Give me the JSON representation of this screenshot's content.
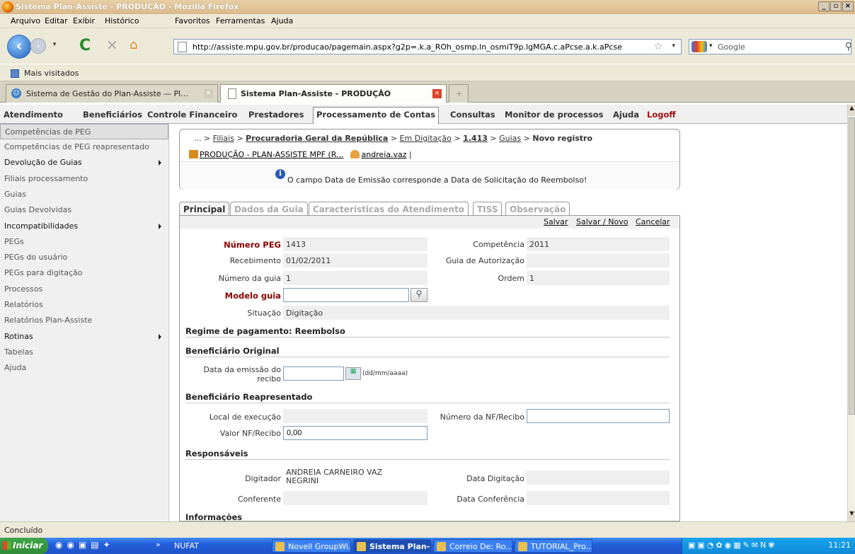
{
  "window": {
    "title": "Sistema Plan-Assiste - PRODUÇÃO - Mozilla Firefox",
    "controls": [
      "_",
      "▫",
      "×"
    ]
  },
  "menu": [
    "Arquivo",
    "Editar",
    "Exibir",
    "Histórico",
    "Favoritos",
    "Ferramentas",
    "Ajuda"
  ],
  "nav": {
    "url": "http://assiste.mpu.gov.br/producao/pagemain.aspx?g2p=.k.a_ROh_osmp.ln_osmiT9p.lgMGA.c.aPcse.a.k.aPcse",
    "search_placeholder": "Google"
  },
  "bookmarks": {
    "label": "Mais visitados"
  },
  "browser_tabs": [
    {
      "label": "Sistema de Gestão do Plan-Assiste — Pl..."
    },
    {
      "label": "Sistema Plan-Assiste - PRODUÇÃO"
    },
    {
      "label": "+"
    }
  ],
  "app_menu": [
    "Atendimento",
    "Beneficiários",
    "Controle Financeiro",
    "Prestadores",
    "Processamento de Contas",
    "Consultas",
    "Monitor de processos",
    "Ajuda",
    "Logoff"
  ],
  "sidebar": [
    {
      "label": "Competências de PEG",
      "sub": false
    },
    {
      "label": "Competências de PEG reapresentado",
      "sub": false
    },
    {
      "label": "Devolução de Guias",
      "sub": true
    },
    {
      "label": "Filiais processamento",
      "sub": false
    },
    {
      "label": "Guias",
      "sub": false
    },
    {
      "label": "Guias Devolvidas",
      "sub": false
    },
    {
      "label": "Incompatibilidades",
      "sub": true
    },
    {
      "label": "PEGs",
      "sub": false
    },
    {
      "label": "PEGs do usuário",
      "sub": false
    },
    {
      "label": "PEGs para digitação",
      "sub": false
    },
    {
      "label": "Processos",
      "sub": false
    },
    {
      "label": "Relatórios",
      "sub": false
    },
    {
      "label": "Relatórios Plan-Assiste",
      "sub": false
    },
    {
      "label": "Rotinas",
      "sub": true
    },
    {
      "label": "Tabelas",
      "sub": false
    },
    {
      "label": "Ajuda",
      "sub": false
    }
  ],
  "breadcrumb": {
    "prefix": "... >",
    "filiais": "Filiais",
    "procuradoria": "Procuradoria Geral da República",
    "em_digitacao": "Em Digitação",
    "peg": "1.413",
    "guias": "Guias",
    "current": "Novo registro",
    "sep": ">"
  },
  "context": {
    "env": "PRODUÇÃO - PLAN-ASSISTE MPF (R...",
    "user": "andreia.vaz",
    "sep": "|"
  },
  "info_message": "O campo Data de Emissão corresponde a Data de Solicitação do Reembolso!",
  "form_tabs": [
    "Principal",
    "Dados da Guia",
    "Características do Atendimento",
    "TISS",
    "Observação"
  ],
  "actions": {
    "save": "Salvar",
    "save_new": "Salvar / Novo",
    "cancel": "Cancelar"
  },
  "form": {
    "numero_peg_label": "Número PEG",
    "numero_peg": "1413",
    "competencia_label": "Competência",
    "competencia": "2011",
    "recebimento_label": "Recebimento",
    "recebimento": "01/02/2011",
    "guia_autorizacao_label": "Guia de Autorização",
    "guia_autorizacao": "",
    "numero_guia_label": "Número da guia",
    "numero_guia": "1",
    "ordem_label": "Ordem",
    "ordem": "1",
    "modelo_guia_label": "Modelo guia",
    "modelo_guia": "",
    "situacao_label": "Situação",
    "situacao": "Digitação",
    "regime": "Regime de pagamento: Reembolso",
    "benef_original": "Beneficiário Original",
    "data_emissao_label_1": "Data da emissão do",
    "data_emissao_label_2": "recibo",
    "data_emissao": "",
    "date_hint": "(dd/mm/aaaa)",
    "benef_reapresentado": "Beneficiário Reapresentado",
    "local_execucao_label": "Local de execução",
    "local_execucao": "",
    "numero_nf_label": "Número da NF/Recibo",
    "numero_nf": "",
    "valor_nf_label": "Valor NF/Recibo",
    "valor_nf": "0,00",
    "responsaveis": "Responsáveis",
    "digitador_label": "Digitador",
    "digitador_1": "ANDREIA CARNEIRO VAZ",
    "digitador_2": "NEGRINI",
    "data_digitacao_label": "Data Digitação",
    "data_digitacao": "",
    "conferente_label": "Conferente",
    "conferente": "",
    "data_conferencia_label": "Data Conferência",
    "data_conferencia": "",
    "informacoes": "Informações"
  },
  "status": "Concluído",
  "taskbar": {
    "start": "Iniciar",
    "quick_more": "»",
    "items": [
      "NUFAT",
      "Novell GroupWi...",
      "Sistema Plan-...",
      "Correio De: Ro...",
      "TUTORIAL_Pro..."
    ],
    "clock": "11:21"
  }
}
